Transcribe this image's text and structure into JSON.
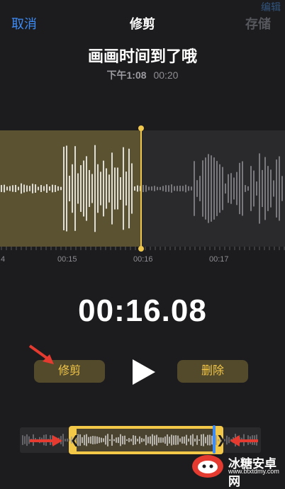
{
  "header": {
    "cancel_label": "取消",
    "title": "修剪",
    "save_label": "存储",
    "ghost_text": "编辑"
  },
  "recording": {
    "name": "画画时间到了哦",
    "date": "下午1:08",
    "duration": "00:20"
  },
  "timeline": {
    "ticks": [
      "4",
      "00:15",
      "00:16",
      "00:17"
    ]
  },
  "player": {
    "current_time": "00:16.08",
    "trim_label": "修剪",
    "delete_label": "删除"
  },
  "watermark": {
    "name": "冰糖安卓网",
    "url": "www.btxtdmy.com"
  },
  "colors": {
    "accent": "#f3c748",
    "blue": "#3d8bf5",
    "background": "#1c1c1e",
    "annotation_arrow": "#e53a2f"
  }
}
